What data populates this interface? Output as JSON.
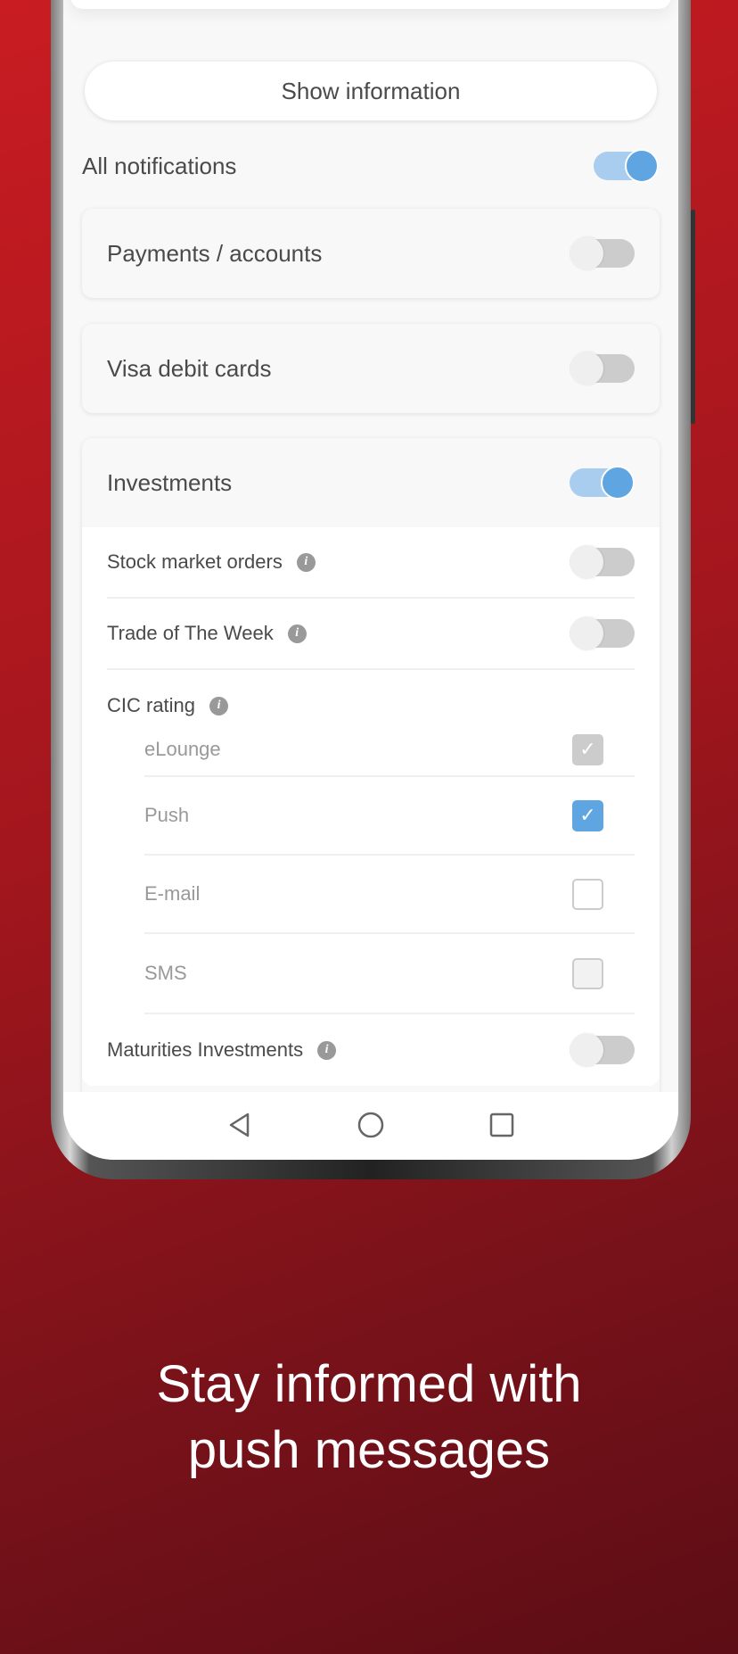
{
  "show_info_label": "Show information",
  "all_notifications": {
    "label": "All notifications",
    "on": true
  },
  "categories": [
    {
      "label": "Payments / accounts",
      "on": false
    },
    {
      "label": "Visa debit cards",
      "on": false
    },
    {
      "label": "Investments",
      "on": true
    }
  ],
  "investments": {
    "items": [
      {
        "label": "Stock market orders",
        "on": false
      },
      {
        "label": "Trade of The Week",
        "on": false
      }
    ],
    "cic_rating": {
      "label": "CIC rating",
      "options": [
        {
          "label": "eLounge",
          "checked": true,
          "disabled": true
        },
        {
          "label": "Push",
          "checked": true
        },
        {
          "label": "E-mail",
          "checked": false
        },
        {
          "label": "SMS",
          "checked": false
        }
      ]
    },
    "maturities": {
      "label": "Maturities Investments",
      "on": false
    }
  },
  "nav": {
    "icons": [
      "back-icon",
      "home-icon",
      "recents-icon"
    ]
  },
  "caption": {
    "line1": "Stay informed with",
    "line2": "push messages"
  },
  "colors": {
    "accent": "#5ea5e2",
    "background_red": "#b0171e"
  }
}
